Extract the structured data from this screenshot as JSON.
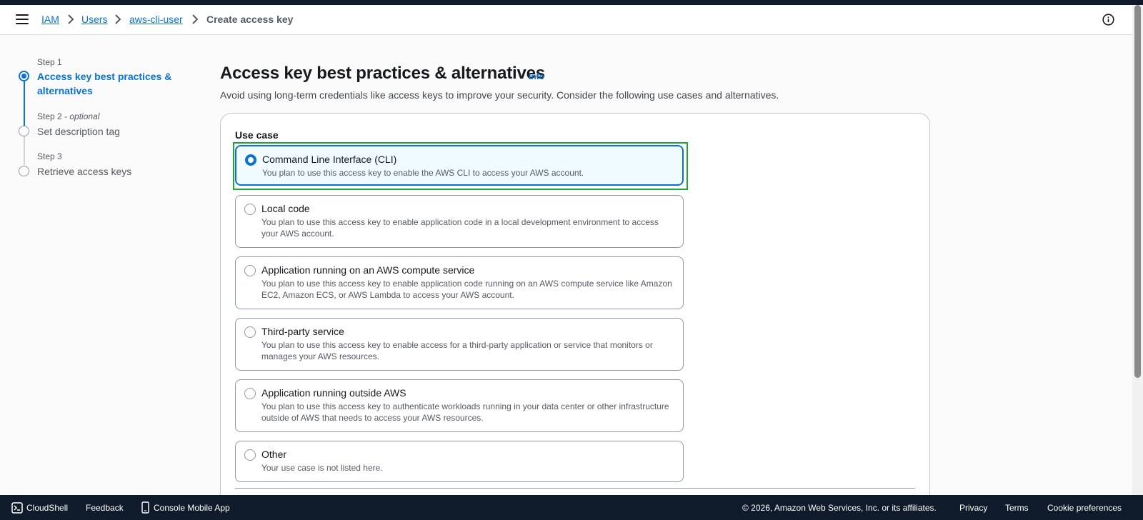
{
  "breadcrumb": {
    "items": [
      "IAM",
      "Users",
      "aws-cli-user"
    ],
    "current": "Create access key"
  },
  "steps": [
    {
      "label": "Step 1",
      "title_line1": "Access key best practices &",
      "title_line2": "alternatives"
    },
    {
      "label": "Step 2",
      "optional": "- optional",
      "title": "Set description tag"
    },
    {
      "label": "Step 3",
      "title": "Retrieve access keys"
    }
  ],
  "main": {
    "title": "Access key best practices & alternatives",
    "info": "Info",
    "description": "Avoid using long-term credentials like access keys to improve your security. Consider the following use cases and alternatives.",
    "use_case_label": "Use case",
    "options": [
      {
        "title": "Command Line Interface (CLI)",
        "desc": "You plan to use this access key to enable the AWS CLI to access your AWS account.",
        "selected": true
      },
      {
        "title": "Local code",
        "desc": "You plan to use this access key to enable application code in a local development environment to access your AWS account.",
        "selected": false
      },
      {
        "title": "Application running on an AWS compute service",
        "desc": "You plan to use this access key to enable application code running on an AWS compute service like Amazon EC2, Amazon ECS, or AWS Lambda to access your AWS account.",
        "selected": false
      },
      {
        "title": "Third-party service",
        "desc": "You plan to use this access key to enable access for a third-party application or service that monitors or manages your AWS resources.",
        "selected": false
      },
      {
        "title": "Application running outside AWS",
        "desc": "You plan to use this access key to authenticate workloads running in your data center or other infrastructure outside of AWS that needs to access your AWS resources.",
        "selected": false
      },
      {
        "title": "Other",
        "desc": "Your use case is not listed here.",
        "selected": false
      }
    ]
  },
  "footer": {
    "cloudshell": "CloudShell",
    "feedback": "Feedback",
    "mobile_app": "Console Mobile App",
    "copyright": "© 2026, Amazon Web Services, Inc. or its affiliates.",
    "privacy": "Privacy",
    "terms": "Terms",
    "cookie": "Cookie preferences"
  },
  "colors": {
    "link": "#0972d3",
    "selection_highlight": "#1fa33a",
    "footer_bg": "#0f1b2a"
  }
}
